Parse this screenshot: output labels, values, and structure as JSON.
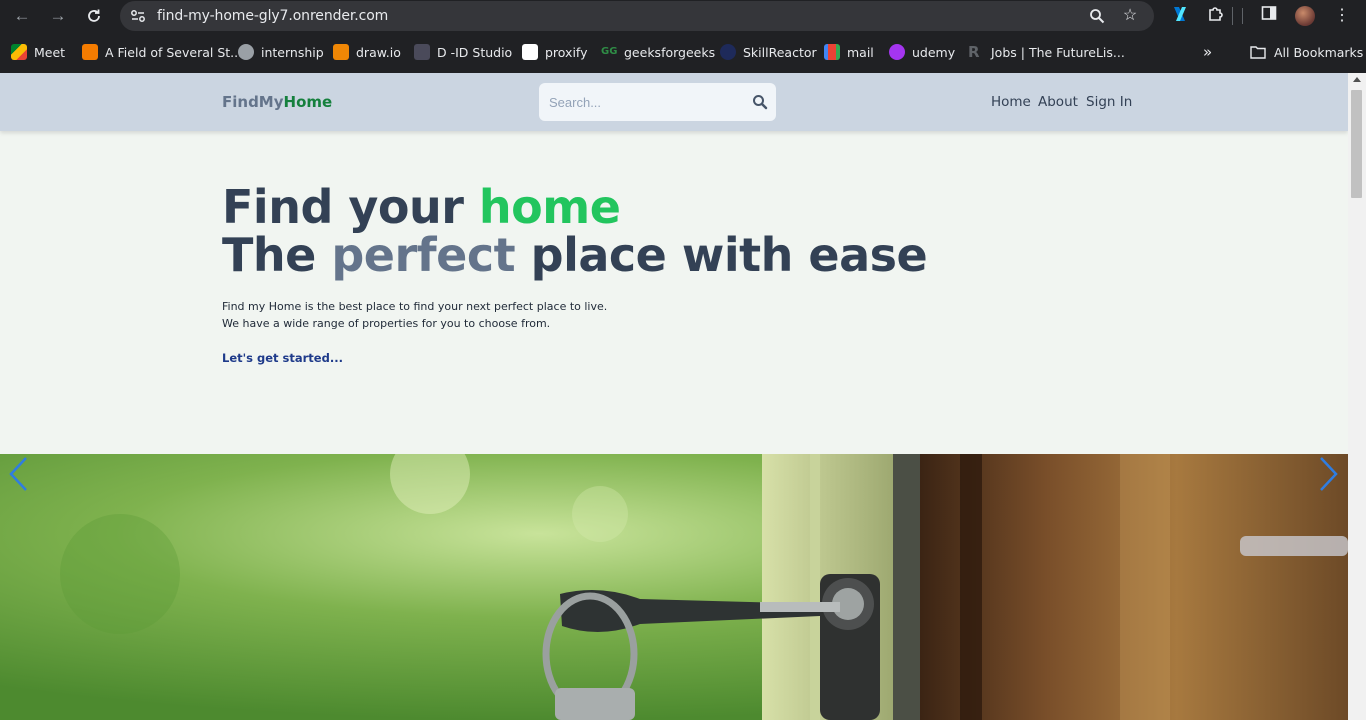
{
  "browser": {
    "url": "find-my-home-gly7.onrender.com",
    "bookmarks": [
      {
        "label": "Meet",
        "icon": "google-meet-icon",
        "color": "#00897b"
      },
      {
        "label": "A Field of Several St...",
        "icon": "blogger-icon",
        "color": "#f57c00"
      },
      {
        "label": "internship",
        "icon": "globe-icon",
        "color": "#9aa0a6"
      },
      {
        "label": "draw.io",
        "icon": "drawio-icon",
        "color": "#f08705"
      },
      {
        "label": "D -ID Studio",
        "icon": "did-icon",
        "color": "#4a4a5a"
      },
      {
        "label": "proxify",
        "icon": "proxify-icon",
        "color": "#ffffff"
      },
      {
        "label": "geeksforgeeks",
        "icon": "gfg-icon",
        "color": "#2f8d46"
      },
      {
        "label": "SkillReactor",
        "icon": "skillreactor-icon",
        "color": "#1e2a5a"
      },
      {
        "label": "mail",
        "icon": "gmail-icon",
        "color": "#ea4335"
      },
      {
        "label": "udemy",
        "icon": "udemy-icon",
        "color": "#a435f0"
      },
      {
        "label": "Jobs | The FutureLis...",
        "icon": "futurelist-icon",
        "color": "#3c3c3c"
      }
    ],
    "more_label": "»",
    "all_bookmarks": "All Bookmarks"
  },
  "site": {
    "logo_part1": "FindMy",
    "logo_part2": "Home",
    "search_placeholder": "Search...",
    "nav": [
      "Home",
      "About",
      "Sign In"
    ]
  },
  "hero": {
    "line1_a": "Find your ",
    "line1_b": "home",
    "line2_a": "The ",
    "line2_b": "perfect",
    "line2_c": " place with ease",
    "desc1": "Find my Home is the best place to find your next perfect place to live.",
    "desc2": "We have a wide range of properties for you to choose from.",
    "cta": "Let's get started..."
  },
  "colors": {
    "header_bg": "#cbd5e1",
    "page_bg": "#f1f5f1",
    "accent_green": "#22c55e",
    "heading": "#334155",
    "cta": "#1e3a8a"
  }
}
